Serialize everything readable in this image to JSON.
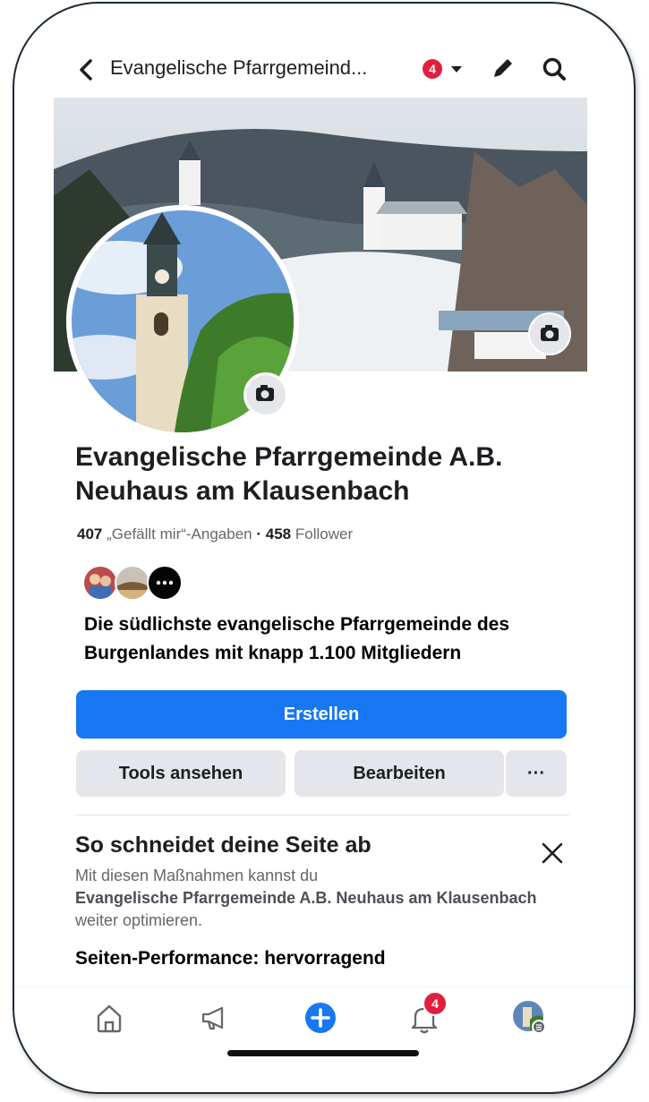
{
  "header": {
    "page_name": "Evangelische Pfarrgemeind...",
    "notification_count": "4"
  },
  "profile": {
    "title": "Evangelische Pfarrgemeinde A.B. Neuhaus am Klausenbach",
    "likes_count": "407",
    "likes_label": "„Gefällt mir“-Angaben",
    "separator": "·",
    "followers_count": "458",
    "followers_label": "Follower",
    "description": "Die südlichste evangelische Pfarrgemeinde des Burgenlandes mit knapp 1.100 Mitgliedern"
  },
  "actions": {
    "create": "Erstellen",
    "tools": "Tools ansehen",
    "edit": "Bearbeiten",
    "more": "···"
  },
  "performance_card": {
    "title": "So schneidet deine Seite ab",
    "body_prefix": "Mit diesen Maßnahmen kannst du",
    "body_page_name": "Evangelische Pfarrgemeinde A.B. Neuhaus am Klausenbach",
    "body_suffix": "weiter optimieren.",
    "performance_text": "Seiten-Performance:  hervorragend"
  },
  "tabbar": {
    "notification_badge": "4",
    "items": [
      "home-icon",
      "megaphone-icon",
      "plus-icon",
      "bell-icon",
      "profile-avatar"
    ]
  },
  "colors": {
    "accent": "#1877f2",
    "badge": "#e41e3f",
    "text": "#1c1e21",
    "muted": "#65676b"
  }
}
